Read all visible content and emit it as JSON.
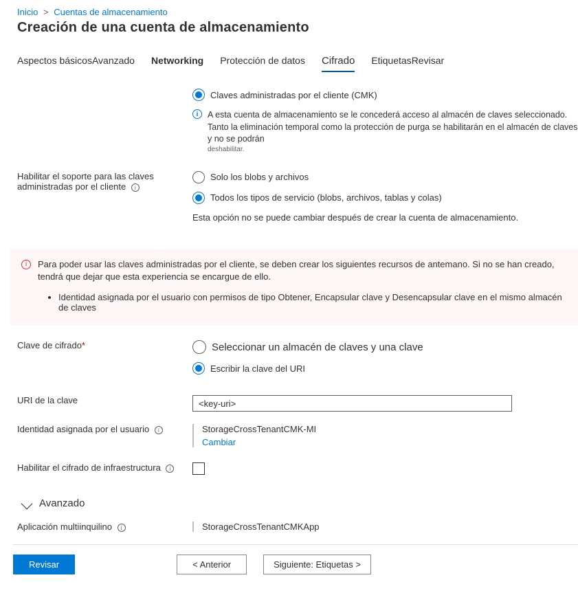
{
  "breadcrumb": {
    "home": "Inicio",
    "sep": ">",
    "storage": "Cuentas de almacenamiento"
  },
  "page_title": "Creación de una cuenta de almacenamiento",
  "tabs": {
    "basics": "Aspectos básicos",
    "advanced": "Avanzado",
    "networking": "Networking",
    "data_protection": "Protección de datos",
    "encryption": "Cifrado",
    "tags": "Etiquetas",
    "review": "Revisar"
  },
  "cmk": {
    "radio_label": "Claves administradas por el cliente (CMK)",
    "note": "A esta cuenta de almacenamiento se le concederá acceso al almacén de claves seleccionado. Tanto la eliminación temporal como la protección de purga se habilitarán en el almacén de claves y no se podrán",
    "note_tail": "deshabilitar."
  },
  "enable_cmk": {
    "label": "Habilitar el soporte para las claves administradas por el cliente",
    "opt1": "Solo los blobs y archivos",
    "opt2": "Todos los tipos de servicio (blobs, archivos, tablas y colas)",
    "sub": "Esta opción no se puede cambiar después de crear la cuenta de almacenamiento."
  },
  "warn": {
    "text": "Para poder usar las claves administradas por el cliente, se deben crear los siguientes recursos de antemano. Si no se han creado, tendrá que dejar que esta experiencia se encargue de ello.",
    "bullet": "Identidad asignada por el usuario con permisos de tipo Obtener, Encapsular clave y Desencapsular clave en el mismo almacén de claves"
  },
  "enc_key": {
    "label": "Clave de cifrado",
    "opt1": "Seleccionar un almacén de claves y una clave",
    "opt2": "Escribir la clave del URI"
  },
  "key_uri": {
    "label": "URI de la clave",
    "value": "<key-uri>"
  },
  "identity": {
    "label": "Identidad asignada por el usuario",
    "value": "StorageCrossTenantCMK-MI",
    "change": "Cambiar"
  },
  "infra_enc": {
    "label": "Habilitar el cifrado de infraestructura"
  },
  "advanced_section": "Avanzado",
  "multi_tenant": {
    "label": "Aplicación multiinquilino",
    "value": "StorageCrossTenantCMKApp"
  },
  "footer": {
    "review": "Revisar",
    "prev": "<  Anterior",
    "next": "Siguiente: Etiquetas >"
  }
}
